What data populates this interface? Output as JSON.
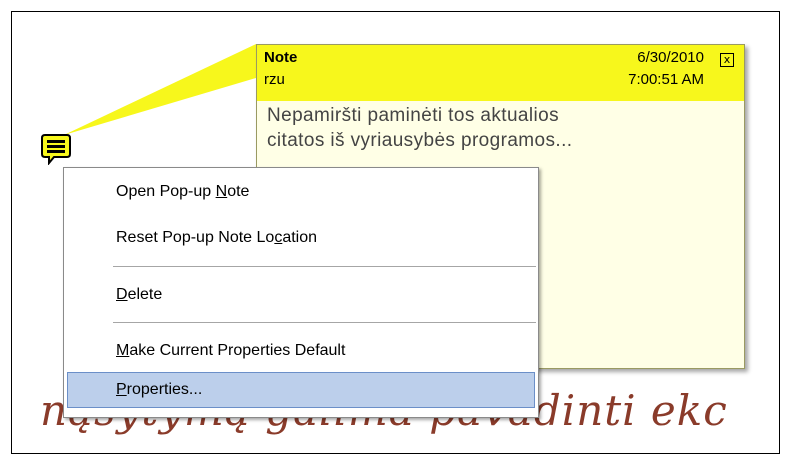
{
  "note": {
    "title": "Note",
    "author": "rzu",
    "date": "6/30/2010",
    "time": "7:00:51 AM",
    "close_glyph": "x",
    "body_lines": [
      "Nepamiršti paminėti tos aktualios",
      "citatos iš vyriausybės programos..."
    ]
  },
  "context_menu": {
    "items": [
      {
        "label": "Open Pop-up Note",
        "mnemonic": "N"
      },
      {
        "label": "Reset Pop-up Note Location",
        "mnemonic": "c"
      },
      {
        "label": "Delete",
        "mnemonic": "D"
      },
      {
        "label": "Make Current Properties Default",
        "mnemonic": "M"
      },
      {
        "label": "Properties...",
        "mnemonic": "P",
        "selected": true
      }
    ]
  },
  "background_text": "nąsytymą galima pavadinti ekc",
  "colors": {
    "note_header": "#f7f71c",
    "note_body": "#ffffe6",
    "menu_highlight": "#bccfeb",
    "background_text": "#8a3b2a"
  },
  "icons": {
    "note_annotation": "comment-note-icon"
  }
}
